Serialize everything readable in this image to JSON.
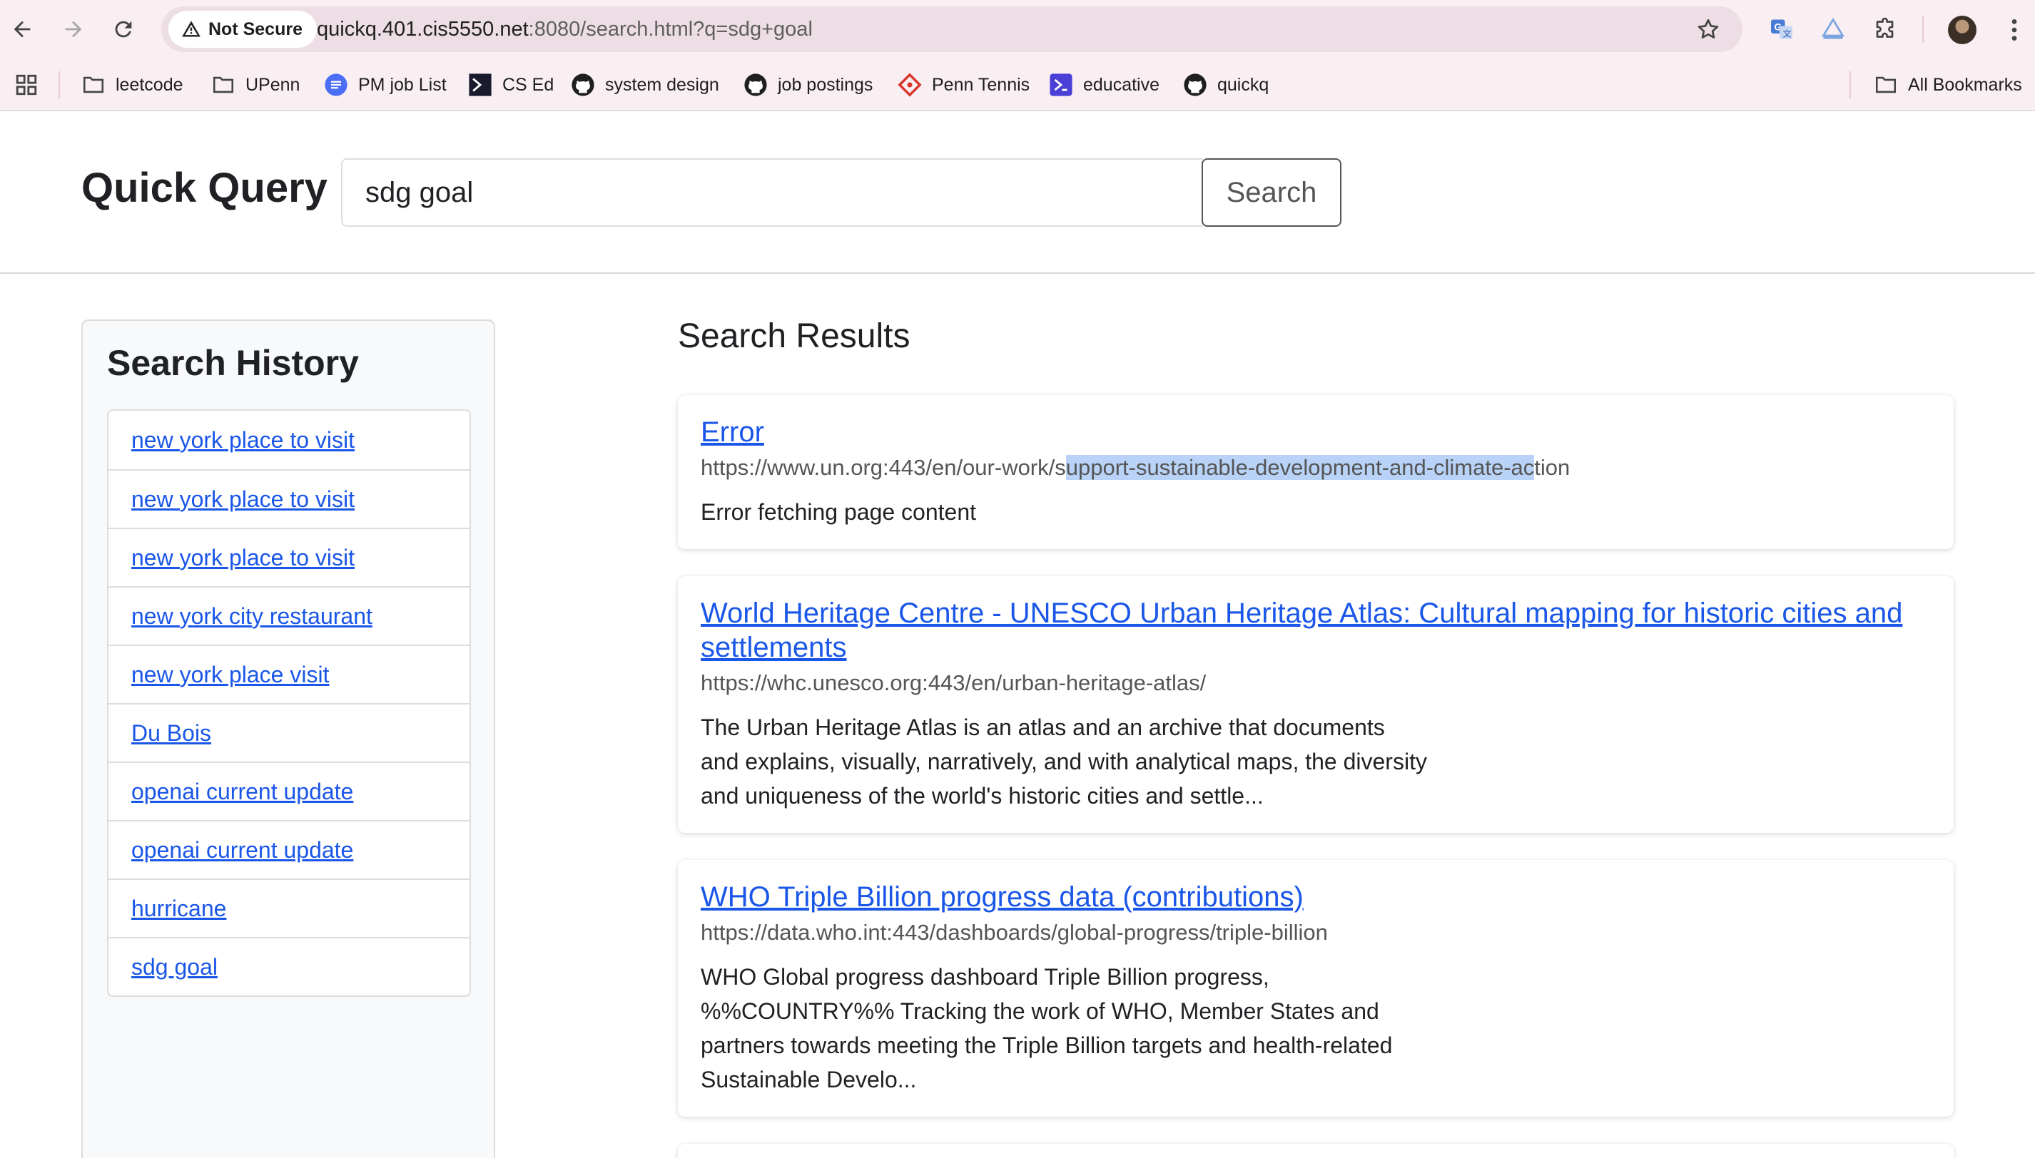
{
  "browser": {
    "security_label": "Not Secure",
    "url_host": "quickq.401.cis5550.net",
    "url_rest": ":8080/search.html?q=sdg+goal",
    "bookmarks": [
      {
        "label": "leetcode",
        "icon": "folder-icon"
      },
      {
        "label": "UPenn",
        "icon": "folder-icon"
      },
      {
        "label": "PM job List",
        "icon": "doc-icon"
      },
      {
        "label": "CS Ed",
        "icon": "terminal-icon"
      },
      {
        "label": "system design",
        "icon": "github-icon"
      },
      {
        "label": "job postings",
        "icon": "github-icon"
      },
      {
        "label": "Penn Tennis",
        "icon": "diamond-icon"
      },
      {
        "label": "educative",
        "icon": "educative-icon"
      },
      {
        "label": "quickq",
        "icon": "github-icon"
      }
    ],
    "all_bookmarks": "All Bookmarks"
  },
  "header": {
    "brand": "Quick Query",
    "search_value": "sdg goal",
    "search_button": "Search"
  },
  "history": {
    "title": "Search History",
    "items": [
      "new york place to visit",
      "new york place to visit",
      "new york place to visit",
      "new york city restaurant",
      "new york place visit",
      "Du Bois",
      "openai current update",
      "openai current update",
      "hurricane",
      "sdg goal"
    ]
  },
  "results": {
    "heading": "Search Results",
    "items": [
      {
        "title": "Error",
        "url_pre": "https://www.un.org:443/en/our-work/s",
        "url_hl": "upport-sustainable-development-and-climate-ac",
        "url_post": "tion",
        "snippet": "Error fetching page content"
      },
      {
        "title": "World Heritage Centre - UNESCO Urban Heritage Atlas: Cultural mapping for historic cities and settlements",
        "url": "https://whc.unesco.org:443/en/urban-heritage-atlas/",
        "snippet": "The Urban Heritage Atlas is an atlas and an archive that documents and explains, visually, narratively, and with analytical maps, the diversity and uniqueness of the world's historic cities and settle..."
      },
      {
        "title": "WHO Triple Billion progress data (contributions)",
        "url": "https://data.who.int:443/dashboards/global-progress/triple-billion",
        "snippet": "WHO Global progress dashboard Triple Billion progress, %%COUNTRY%% Tracking the work of WHO, Member States and partners towards meeting the Triple Billion targets and health-related Sustainable Develo..."
      }
    ]
  }
}
